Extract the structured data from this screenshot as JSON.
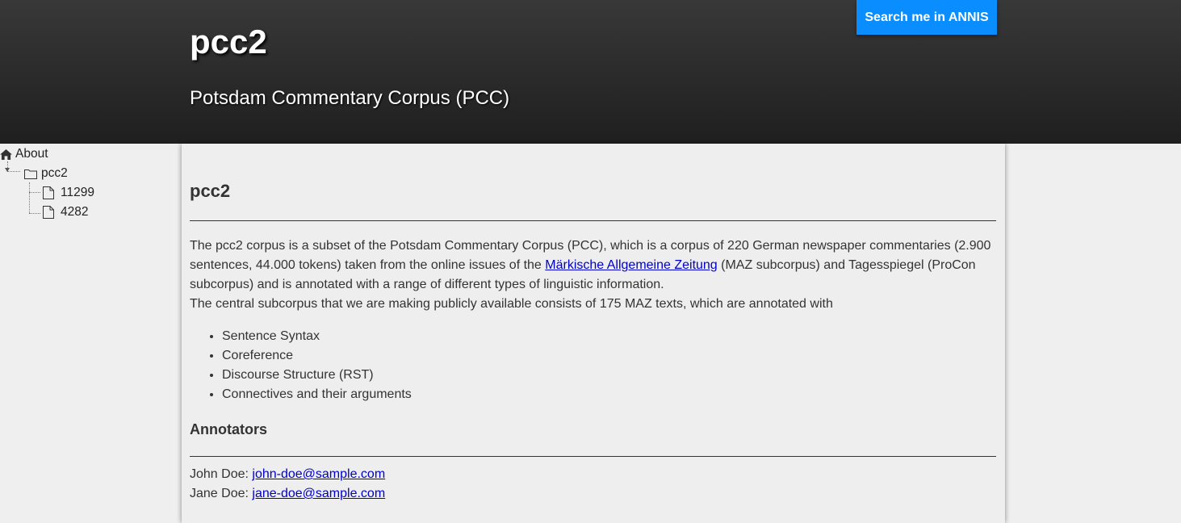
{
  "header": {
    "title": "pcc2",
    "subtitle": "Potsdam Commentary Corpus (PCC)",
    "search_button": "Search me in ANNIS"
  },
  "sidebar": {
    "root": "About",
    "corpus": "pcc2",
    "documents": [
      "11299",
      "4282"
    ]
  },
  "main": {
    "title": "pcc2",
    "intro_before_link": "The pcc2 corpus is a subset of the Potsdam Commentary Corpus (PCC), which is a corpus of 220 German newspaper commentaries (2.900 sentences, 44.000 tokens) taken from the online issues of the ",
    "intro_link": "Märkische Allgemeine Zeitung",
    "intro_after_link": " (MAZ subcorpus) and Tagesspiegel (ProCon subcorpus) and is annotated with a range of different types of linguistic information.",
    "intro_second": "The central subcorpus that we are making publicly available consists of 175 MAZ texts, which are annotated with",
    "annotations": [
      "Sentence Syntax",
      "Coreference",
      "Discourse Structure (RST)",
      "Connectives and their arguments"
    ],
    "annotators_heading": "Annotators",
    "annotators": [
      {
        "name": "John Doe: ",
        "email": "john-doe@sample.com"
      },
      {
        "name": "Jane Doe: ",
        "email": "jane-doe@sample.com"
      }
    ]
  },
  "colors": {
    "button_bg": "#0a8eff",
    "header_bg": "#2a2a2a",
    "page_bg": "#efefef",
    "link": "#0000cc"
  },
  "icons": {
    "root": "home-icon",
    "corpus": "folder-icon",
    "document": "file-icon"
  }
}
